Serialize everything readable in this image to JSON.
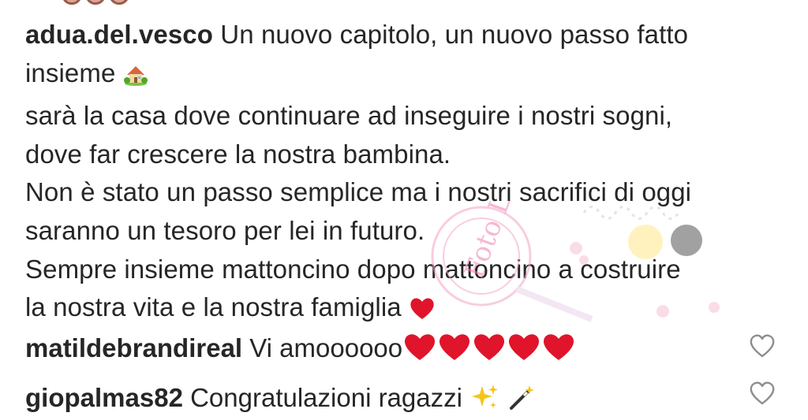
{
  "post": {
    "author": "adua.del.vesco",
    "caption_lines": [
      "Un nuovo capitolo, un nuovo passo fatto",
      "insieme",
      "sarà la casa dove continuare ad inseguire i nostri sogni,",
      "dove far crescere la nostra bambina.",
      "Non è stato un passo semplice ma i nostri sacrifici di oggi",
      "saranno un tesoro per lei in futuro.",
      "Sempre insieme mattoncino dopo mattoncino a costruire",
      "la nostra vita e la nostra famiglia"
    ]
  },
  "comments": [
    {
      "username": "matildebrandireal",
      "text": "Vi amoooooo"
    },
    {
      "username": "giopalmas82",
      "text": "Congratulazioni ragazzi"
    }
  ],
  "watermark": {
    "text": "Foto Lovers"
  },
  "icons": {
    "like": "heart-outline-icon",
    "house": "house-with-garden-emoji",
    "red_heart": "red-heart-emoji",
    "sparkles": "sparkles-emoji",
    "magic_wand": "magic-wand-emoji"
  },
  "colors": {
    "text": "#262626",
    "heart_emoji": "#e0142a",
    "sparkles": "#f5c518",
    "like_outline": "#8e8e8e",
    "watermark": "#f4a6c8"
  }
}
